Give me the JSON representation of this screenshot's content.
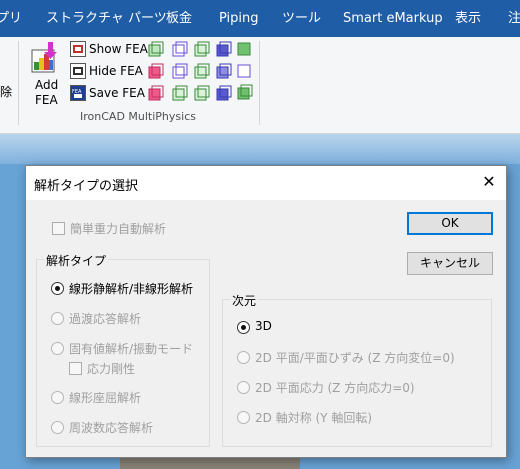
{
  "tabs": [
    "プリ",
    "ストラクチャ パーツ",
    "板金",
    "Piping",
    "ツール",
    "Smart eMarkup",
    "表示",
    "注"
  ],
  "ribbon": {
    "left_clipped_label": "除",
    "add_fea": {
      "line1": "Add",
      "line2": "FEA"
    },
    "show_fea": "Show FEA",
    "hide_fea": "Hide FEA",
    "save_fea": "Save FEA",
    "group_label": "IronCAD MultiPhysics"
  },
  "dialog": {
    "title": "解析タイプの選択",
    "close": "✕",
    "simple_gravity": "簡単重力自動解析",
    "analysis_type_group": "解析タイプ",
    "analysis_types": [
      {
        "label": "線形静解析/非線形解析",
        "selected": true,
        "enabled": true
      },
      {
        "label": "過渡応答解析",
        "selected": false,
        "enabled": false
      },
      {
        "label": "固有値解析/振動モード",
        "selected": false,
        "enabled": false
      },
      {
        "label": "線形座屈解析",
        "selected": false,
        "enabled": false
      },
      {
        "label": "周波数応答解析",
        "selected": false,
        "enabled": false
      }
    ],
    "stress_stiffness": "応力剛性",
    "dimension_group": "次元",
    "dimensions": [
      {
        "label": "3D",
        "selected": true,
        "enabled": true
      },
      {
        "label": "2D 平面/平面ひずみ (Z 方向変位=0)",
        "selected": false,
        "enabled": false
      },
      {
        "label": "2D 平面応力 (Z 方向応力=0)",
        "selected": false,
        "enabled": false
      },
      {
        "label": "2D 軸対称 (Y 軸回転)",
        "selected": false,
        "enabled": false
      }
    ],
    "ok": "OK",
    "cancel": "キャンセル"
  },
  "colors": {
    "tabbar": "#1f5da6",
    "canvas": "#68a3d6",
    "default_button_border": "#0078d7"
  }
}
